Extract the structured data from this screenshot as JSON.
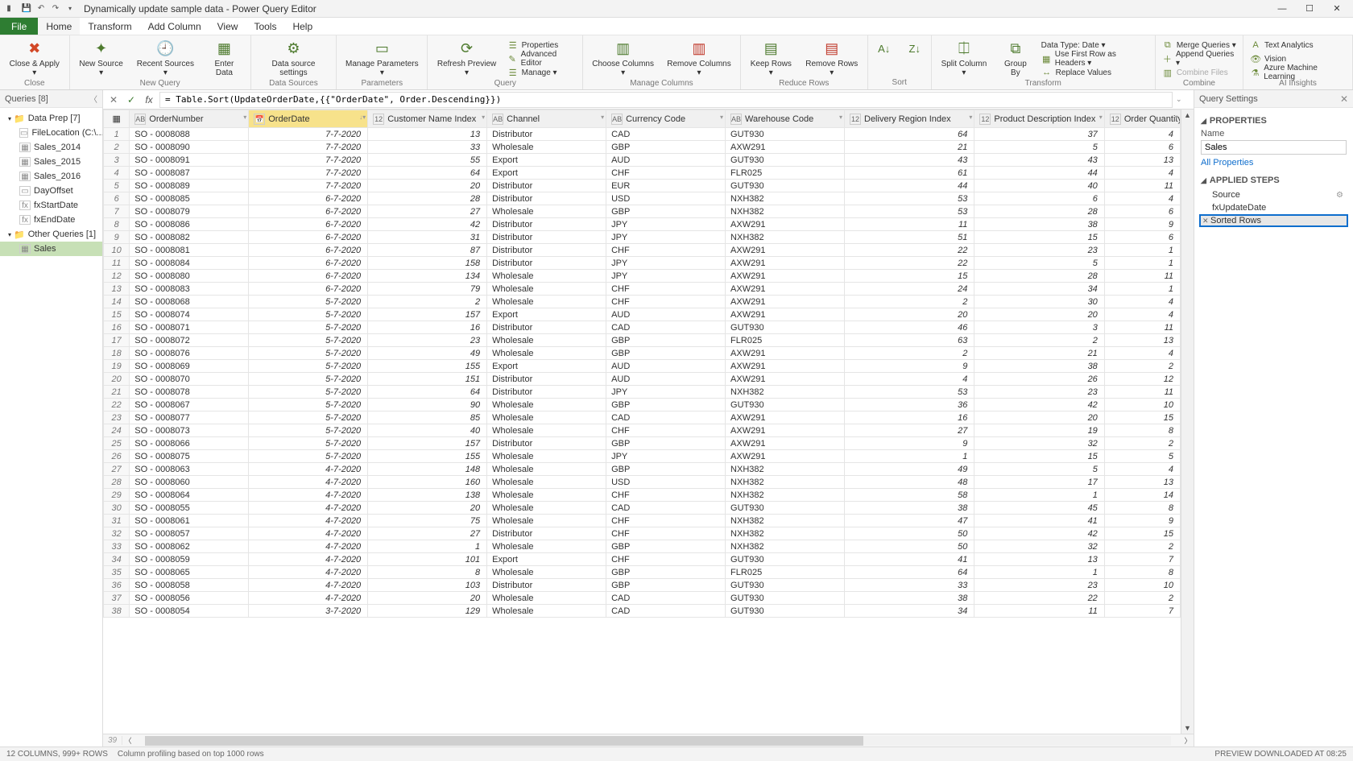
{
  "title": "Dynamically update sample data - Power Query Editor",
  "menu": {
    "file": "File",
    "home": "Home",
    "transform": "Transform",
    "addcol": "Add Column",
    "view": "View",
    "tools": "Tools",
    "help": "Help"
  },
  "ribbon": {
    "close": {
      "btn": "Close &\nApply ▾",
      "group": "Close"
    },
    "newquery": {
      "new_source": "New\nSource ▾",
      "recent": "Recent\nSources ▾",
      "enter": "Enter\nData",
      "group": "New Query"
    },
    "ds": {
      "settings": "Data source\nsettings",
      "group": "Data Sources"
    },
    "params": {
      "manage": "Manage\nParameters ▾",
      "group": "Parameters"
    },
    "query": {
      "refresh": "Refresh\nPreview ▾",
      "props": "Properties",
      "adv": "Advanced Editor",
      "mng": "Manage ▾",
      "group": "Query"
    },
    "cols": {
      "choose": "Choose\nColumns ▾",
      "remove": "Remove\nColumns ▾",
      "group": "Manage Columns"
    },
    "rows": {
      "keep": "Keep\nRows ▾",
      "remove": "Remove\nRows ▾",
      "group": "Reduce Rows"
    },
    "sort": {
      "group": "Sort"
    },
    "transform": {
      "split": "Split\nColumn ▾",
      "group_by": "Group\nBy",
      "dtype": "Data Type: Date ▾",
      "firstrow": "Use First Row as Headers ▾",
      "replace": "Replace Values",
      "group": "Transform"
    },
    "combine": {
      "merge": "Merge Queries ▾",
      "append": "Append Queries ▾",
      "files": "Combine Files",
      "group": "Combine"
    },
    "ai": {
      "ta": "Text Analytics",
      "vision": "Vision",
      "aml": "Azure Machine Learning",
      "group": "AI Insights"
    }
  },
  "queries_header": "Queries [8]",
  "tree": {
    "g1": "Data Prep [7]",
    "i1": "FileLocation (C:\\...",
    "i2": "Sales_2014",
    "i3": "Sales_2015",
    "i4": "Sales_2016",
    "i5": "DayOffset",
    "i6": "fxStartDate",
    "i7": "fxEndDate",
    "g2": "Other Queries [1]",
    "i8": "Sales"
  },
  "formula": "= Table.Sort(UpdateOrderDate,{{\"OrderDate\", Order.Descending}})",
  "columns": {
    "c0": "",
    "c1": "OrderNumber",
    "c2": "OrderDate",
    "c3": "Customer Name Index",
    "c4": "Channel",
    "c5": "Currency Code",
    "c6": "Warehouse Code",
    "c7": "Delivery Region Index",
    "c8": "Product Description Index",
    "c9": "Order Quantity"
  },
  "rows": [
    {
      "n": 1,
      "o": "SO - 0008088",
      "d": "7-7-2020",
      "ci": 13,
      "ch": "Distributor",
      "cc": "CAD",
      "w": "GUT930",
      "r": 64,
      "p": 37,
      "q": 4
    },
    {
      "n": 2,
      "o": "SO - 0008090",
      "d": "7-7-2020",
      "ci": 33,
      "ch": "Wholesale",
      "cc": "GBP",
      "w": "AXW291",
      "r": 21,
      "p": 5,
      "q": 6
    },
    {
      "n": 3,
      "o": "SO - 0008091",
      "d": "7-7-2020",
      "ci": 55,
      "ch": "Export",
      "cc": "AUD",
      "w": "GUT930",
      "r": 43,
      "p": 43,
      "q": 13
    },
    {
      "n": 4,
      "o": "SO - 0008087",
      "d": "7-7-2020",
      "ci": 64,
      "ch": "Export",
      "cc": "CHF",
      "w": "FLR025",
      "r": 61,
      "p": 44,
      "q": 4
    },
    {
      "n": 5,
      "o": "SO - 0008089",
      "d": "7-7-2020",
      "ci": 20,
      "ch": "Distributor",
      "cc": "EUR",
      "w": "GUT930",
      "r": 44,
      "p": 40,
      "q": 11
    },
    {
      "n": 6,
      "o": "SO - 0008085",
      "d": "6-7-2020",
      "ci": 28,
      "ch": "Distributor",
      "cc": "USD",
      "w": "NXH382",
      "r": 53,
      "p": 6,
      "q": 4
    },
    {
      "n": 7,
      "o": "SO - 0008079",
      "d": "6-7-2020",
      "ci": 27,
      "ch": "Wholesale",
      "cc": "GBP",
      "w": "NXH382",
      "r": 53,
      "p": 28,
      "q": 6
    },
    {
      "n": 8,
      "o": "SO - 0008086",
      "d": "6-7-2020",
      "ci": 42,
      "ch": "Distributor",
      "cc": "JPY",
      "w": "AXW291",
      "r": 11,
      "p": 38,
      "q": 9
    },
    {
      "n": 9,
      "o": "SO - 0008082",
      "d": "6-7-2020",
      "ci": 31,
      "ch": "Distributor",
      "cc": "JPY",
      "w": "NXH382",
      "r": 51,
      "p": 15,
      "q": 6
    },
    {
      "n": 10,
      "o": "SO - 0008081",
      "d": "6-7-2020",
      "ci": 87,
      "ch": "Distributor",
      "cc": "CHF",
      "w": "AXW291",
      "r": 22,
      "p": 23,
      "q": 1
    },
    {
      "n": 11,
      "o": "SO - 0008084",
      "d": "6-7-2020",
      "ci": 158,
      "ch": "Distributor",
      "cc": "JPY",
      "w": "AXW291",
      "r": 22,
      "p": 5,
      "q": 1
    },
    {
      "n": 12,
      "o": "SO - 0008080",
      "d": "6-7-2020",
      "ci": 134,
      "ch": "Wholesale",
      "cc": "JPY",
      "w": "AXW291",
      "r": 15,
      "p": 28,
      "q": 11
    },
    {
      "n": 13,
      "o": "SO - 0008083",
      "d": "6-7-2020",
      "ci": 79,
      "ch": "Wholesale",
      "cc": "CHF",
      "w": "AXW291",
      "r": 24,
      "p": 34,
      "q": 1
    },
    {
      "n": 14,
      "o": "SO - 0008068",
      "d": "5-7-2020",
      "ci": 2,
      "ch": "Wholesale",
      "cc": "CHF",
      "w": "AXW291",
      "r": 2,
      "p": 30,
      "q": 4
    },
    {
      "n": 15,
      "o": "SO - 0008074",
      "d": "5-7-2020",
      "ci": 157,
      "ch": "Export",
      "cc": "AUD",
      "w": "AXW291",
      "r": 20,
      "p": 20,
      "q": 4
    },
    {
      "n": 16,
      "o": "SO - 0008071",
      "d": "5-7-2020",
      "ci": 16,
      "ch": "Distributor",
      "cc": "CAD",
      "w": "GUT930",
      "r": 46,
      "p": 3,
      "q": 11
    },
    {
      "n": 17,
      "o": "SO - 0008072",
      "d": "5-7-2020",
      "ci": 23,
      "ch": "Wholesale",
      "cc": "GBP",
      "w": "FLR025",
      "r": 63,
      "p": 2,
      "q": 13
    },
    {
      "n": 18,
      "o": "SO - 0008076",
      "d": "5-7-2020",
      "ci": 49,
      "ch": "Wholesale",
      "cc": "GBP",
      "w": "AXW291",
      "r": 2,
      "p": 21,
      "q": 4
    },
    {
      "n": 19,
      "o": "SO - 0008069",
      "d": "5-7-2020",
      "ci": 155,
      "ch": "Export",
      "cc": "AUD",
      "w": "AXW291",
      "r": 9,
      "p": 38,
      "q": 2
    },
    {
      "n": 20,
      "o": "SO - 0008070",
      "d": "5-7-2020",
      "ci": 151,
      "ch": "Distributor",
      "cc": "AUD",
      "w": "AXW291",
      "r": 4,
      "p": 26,
      "q": 12
    },
    {
      "n": 21,
      "o": "SO - 0008078",
      "d": "5-7-2020",
      "ci": 64,
      "ch": "Distributor",
      "cc": "JPY",
      "w": "NXH382",
      "r": 53,
      "p": 23,
      "q": 11
    },
    {
      "n": 22,
      "o": "SO - 0008067",
      "d": "5-7-2020",
      "ci": 90,
      "ch": "Wholesale",
      "cc": "GBP",
      "w": "GUT930",
      "r": 36,
      "p": 42,
      "q": 10
    },
    {
      "n": 23,
      "o": "SO - 0008077",
      "d": "5-7-2020",
      "ci": 85,
      "ch": "Wholesale",
      "cc": "CAD",
      "w": "AXW291",
      "r": 16,
      "p": 20,
      "q": 15
    },
    {
      "n": 24,
      "o": "SO - 0008073",
      "d": "5-7-2020",
      "ci": 40,
      "ch": "Wholesale",
      "cc": "CHF",
      "w": "AXW291",
      "r": 27,
      "p": 19,
      "q": 8
    },
    {
      "n": 25,
      "o": "SO - 0008066",
      "d": "5-7-2020",
      "ci": 157,
      "ch": "Distributor",
      "cc": "GBP",
      "w": "AXW291",
      "r": 9,
      "p": 32,
      "q": 2
    },
    {
      "n": 26,
      "o": "SO - 0008075",
      "d": "5-7-2020",
      "ci": 155,
      "ch": "Wholesale",
      "cc": "JPY",
      "w": "AXW291",
      "r": 1,
      "p": 15,
      "q": 5
    },
    {
      "n": 27,
      "o": "SO - 0008063",
      "d": "4-7-2020",
      "ci": 148,
      "ch": "Wholesale",
      "cc": "GBP",
      "w": "NXH382",
      "r": 49,
      "p": 5,
      "q": 4
    },
    {
      "n": 28,
      "o": "SO - 0008060",
      "d": "4-7-2020",
      "ci": 160,
      "ch": "Wholesale",
      "cc": "USD",
      "w": "NXH382",
      "r": 48,
      "p": 17,
      "q": 13
    },
    {
      "n": 29,
      "o": "SO - 0008064",
      "d": "4-7-2020",
      "ci": 138,
      "ch": "Wholesale",
      "cc": "CHF",
      "w": "NXH382",
      "r": 58,
      "p": 1,
      "q": 14
    },
    {
      "n": 30,
      "o": "SO - 0008055",
      "d": "4-7-2020",
      "ci": 20,
      "ch": "Wholesale",
      "cc": "CAD",
      "w": "GUT930",
      "r": 38,
      "p": 45,
      "q": 8
    },
    {
      "n": 31,
      "o": "SO - 0008061",
      "d": "4-7-2020",
      "ci": 75,
      "ch": "Wholesale",
      "cc": "CHF",
      "w": "NXH382",
      "r": 47,
      "p": 41,
      "q": 9
    },
    {
      "n": 32,
      "o": "SO - 0008057",
      "d": "4-7-2020",
      "ci": 27,
      "ch": "Distributor",
      "cc": "CHF",
      "w": "NXH382",
      "r": 50,
      "p": 42,
      "q": 15
    },
    {
      "n": 33,
      "o": "SO - 0008062",
      "d": "4-7-2020",
      "ci": 1,
      "ch": "Wholesale",
      "cc": "GBP",
      "w": "NXH382",
      "r": 50,
      "p": 32,
      "q": 2
    },
    {
      "n": 34,
      "o": "SO - 0008059",
      "d": "4-7-2020",
      "ci": 101,
      "ch": "Export",
      "cc": "CHF",
      "w": "GUT930",
      "r": 41,
      "p": 13,
      "q": 7
    },
    {
      "n": 35,
      "o": "SO - 0008065",
      "d": "4-7-2020",
      "ci": 8,
      "ch": "Wholesale",
      "cc": "GBP",
      "w": "FLR025",
      "r": 64,
      "p": 1,
      "q": 8
    },
    {
      "n": 36,
      "o": "SO - 0008058",
      "d": "4-7-2020",
      "ci": 103,
      "ch": "Distributor",
      "cc": "GBP",
      "w": "GUT930",
      "r": 33,
      "p": 23,
      "q": 10
    },
    {
      "n": 37,
      "o": "SO - 0008056",
      "d": "4-7-2020",
      "ci": 20,
      "ch": "Wholesale",
      "cc": "CAD",
      "w": "GUT930",
      "r": 38,
      "p": 22,
      "q": 2
    },
    {
      "n": 38,
      "o": "SO - 0008054",
      "d": "3-7-2020",
      "ci": 129,
      "ch": "Wholesale",
      "cc": "CAD",
      "w": "GUT930",
      "r": 34,
      "p": 11,
      "q": 7
    }
  ],
  "next_row": "39",
  "settings": {
    "header": "Query Settings",
    "props": "PROPERTIES",
    "name_label": "Name",
    "name_val": "Sales",
    "all_props": "All Properties",
    "steps_hdr": "APPLIED STEPS",
    "s1": "Source",
    "s2": "fxUpdateDate",
    "s3": "Sorted Rows"
  },
  "status": {
    "left1": "12 COLUMNS, 999+ ROWS",
    "left2": "Column profiling based on top 1000 rows",
    "right": "PREVIEW DOWNLOADED AT 08:25"
  }
}
